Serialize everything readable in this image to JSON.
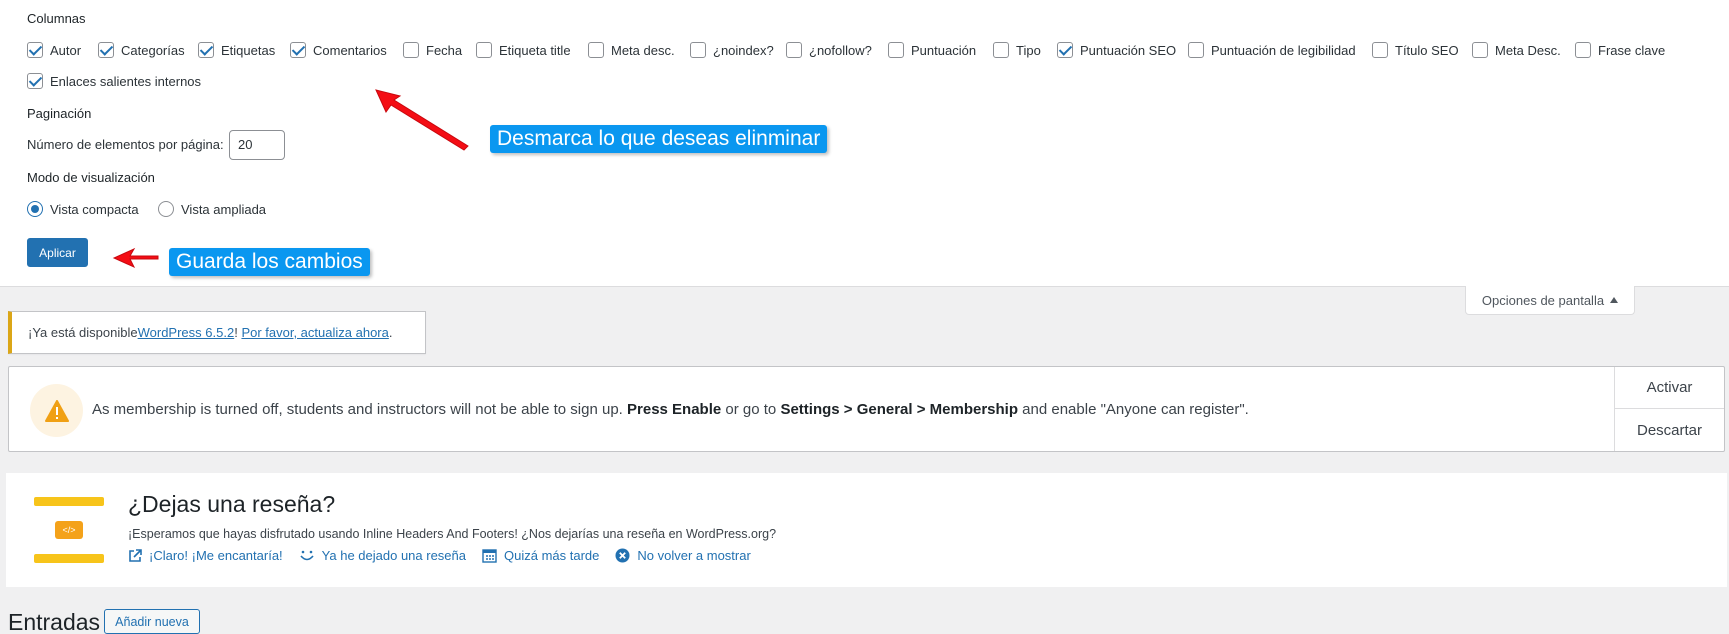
{
  "screen_options": {
    "columns_heading": "Columnas",
    "columns": [
      {
        "label": "Autor",
        "checked": true
      },
      {
        "label": "Categorías",
        "checked": true
      },
      {
        "label": "Etiquetas",
        "checked": true
      },
      {
        "label": "Comentarios",
        "checked": true
      },
      {
        "label": "Fecha",
        "checked": false
      },
      {
        "label": "Etiqueta title",
        "checked": false
      },
      {
        "label": "Meta desc.",
        "checked": false
      },
      {
        "label": "¿noindex?",
        "checked": false
      },
      {
        "label": "¿nofollow?",
        "checked": false
      },
      {
        "label": "Puntuación",
        "checked": false
      },
      {
        "label": "Tipo",
        "checked": false
      },
      {
        "label": "Puntuación SEO",
        "checked": true
      },
      {
        "label": "Puntuación de legibilidad",
        "checked": false
      },
      {
        "label": "Título SEO",
        "checked": false
      },
      {
        "label": "Meta Desc.",
        "checked": false
      },
      {
        "label": "Frase clave",
        "checked": false
      },
      {
        "label": "Enlaces salientes internos",
        "checked": true
      }
    ],
    "pagination_heading": "Paginación",
    "per_page_label": "Número de elementos por página:",
    "per_page_value": "20",
    "view_mode_heading": "Modo de visualización",
    "view_modes": [
      {
        "label": "Vista compacta",
        "checked": true
      },
      {
        "label": "Vista ampliada",
        "checked": false
      }
    ],
    "apply_label": "Aplicar",
    "tab_label": "Opciones de pantalla"
  },
  "annotations": {
    "callout_1": "Desmarca lo que deseas elinminar",
    "callout_2": "Guarda los cambios",
    "callout_color": "#0a97f0",
    "arrow_color": "#f40d14"
  },
  "update_notice": {
    "prefix": "¡Ya está disponible ",
    "version_link": "WordPress 6.5.2",
    "middle": "! ",
    "update_link": "Por favor, actualiza ahora",
    "suffix": "."
  },
  "membership_notice": {
    "icon": "warning-icon",
    "text_1": "As membership is turned off, students and instructors will not be able to sign up. ",
    "bold_1": "Press Enable",
    "text_2": " or go to ",
    "bold_2": "Settings > General > Membership",
    "text_3": " and enable \"Anyone can register\".",
    "activate_label": "Activar",
    "dismiss_label": "Descartar"
  },
  "review_notice": {
    "logo_badge": "</>",
    "title": "¿Dejas una reseña?",
    "description": "¡Esperamos que hayas disfrutado usando Inline Headers And Footers! ¿Nos dejarías una reseña en WordPress.org?",
    "links": [
      {
        "icon": "external-link-icon",
        "label": "¡Claro! ¡Me encantaría!"
      },
      {
        "icon": "smile-icon",
        "label": "Ya he dejado una reseña"
      },
      {
        "icon": "calendar-icon",
        "label": "Quizá más tarde"
      },
      {
        "icon": "close-circle-icon",
        "label": "No volver a mostrar"
      }
    ]
  },
  "page": {
    "title": "Entradas",
    "add_new_label": "Añadir nueva"
  }
}
